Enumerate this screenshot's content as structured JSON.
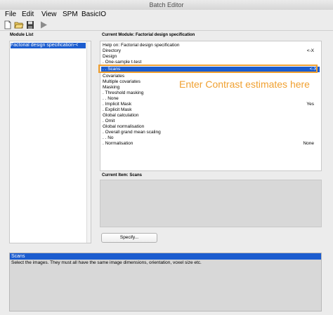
{
  "window": {
    "title": "Batch Editor"
  },
  "menu": [
    "File",
    "Edit",
    "View",
    "SPM",
    "BasicIO"
  ],
  "toolbar": {
    "icons": [
      "new-file-icon",
      "open-folder-icon",
      "save-icon",
      "run-icon"
    ]
  },
  "module_list": {
    "label": "Module List",
    "items": [
      "Factorial design specification-<"
    ]
  },
  "current_module": {
    "label": "Current Module: Factorial design specification",
    "rows": [
      {
        "text": "Help on: Factorial design specification",
        "value": ""
      },
      {
        "text": "Directory",
        "value": "<-X"
      },
      {
        "text": "Design",
        "value": ""
      },
      {
        "text": ". One-sample t-test",
        "value": ""
      },
      {
        "text": ". . Scans",
        "value": "<-X",
        "selected": true
      },
      {
        "text": "Covariates",
        "value": ""
      },
      {
        "text": "Multiple covariates",
        "value": ""
      },
      {
        "text": "Masking",
        "value": ""
      },
      {
        "text": ". Threshold masking",
        "value": ""
      },
      {
        "text": ". . None",
        "value": ""
      },
      {
        "text": ". Implicit Mask",
        "value": "Yes"
      },
      {
        "text": ". Explicit Mask",
        "value": ""
      },
      {
        "text": "Global calculation",
        "value": ""
      },
      {
        "text": ". Omit",
        "value": ""
      },
      {
        "text": "Global normalisation",
        "value": ""
      },
      {
        "text": ". Overall grand mean scaling",
        "value": ""
      },
      {
        "text": ". . No",
        "value": ""
      },
      {
        "text": ". Normalisation",
        "value": "None"
      }
    ]
  },
  "annotation": {
    "text": "Enter Contrast estimates here",
    "color": "#f0a030"
  },
  "current_item": {
    "label": "Current Item: Scans"
  },
  "specify_button": {
    "label": "Specify..."
  },
  "help": {
    "title": "Scans",
    "text": "Select the images.  They must all have the same image dimensions, orientation, voxel size etc."
  },
  "colors": {
    "selection": "#1b5ccf",
    "annotation": "#f0a030"
  }
}
